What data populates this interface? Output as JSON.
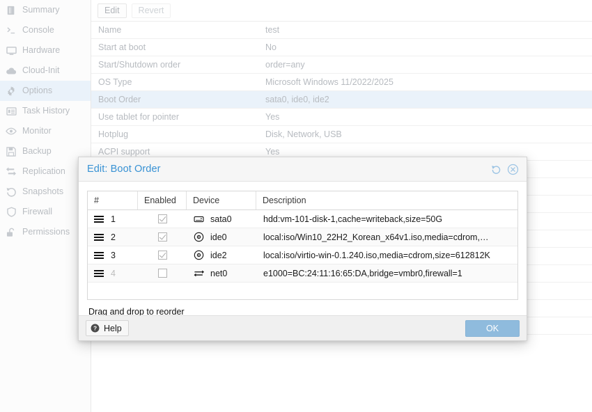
{
  "sidebar": {
    "items": [
      {
        "label": "Summary",
        "icon": "summary-icon",
        "selected": false
      },
      {
        "label": "Console",
        "icon": "console-icon",
        "selected": false
      },
      {
        "label": "Hardware",
        "icon": "hardware-icon",
        "selected": false
      },
      {
        "label": "Cloud-Init",
        "icon": "cloud-icon",
        "selected": false
      },
      {
        "label": "Options",
        "icon": "gear-icon",
        "selected": true
      },
      {
        "label": "Task History",
        "icon": "task-history-icon",
        "selected": false
      },
      {
        "label": "Monitor",
        "icon": "eye-icon",
        "selected": false
      },
      {
        "label": "Backup",
        "icon": "floppy-icon",
        "selected": false
      },
      {
        "label": "Replication",
        "icon": "replication-icon",
        "selected": false
      },
      {
        "label": "Snapshots",
        "icon": "snapshot-icon",
        "selected": false
      },
      {
        "label": "Firewall",
        "icon": "shield-icon",
        "selected": false
      },
      {
        "label": "Permissions",
        "icon": "unlock-icon",
        "selected": false
      }
    ]
  },
  "toolbar": {
    "edit_label": "Edit",
    "revert_label": "Revert"
  },
  "options_table": {
    "rows": [
      {
        "key": "Name",
        "value": "test",
        "highlight": false
      },
      {
        "key": "Start at boot",
        "value": "No",
        "highlight": false
      },
      {
        "key": "Start/Shutdown order",
        "value": "order=any",
        "highlight": false
      },
      {
        "key": "OS Type",
        "value": "Microsoft Windows 11/2022/2025",
        "highlight": false
      },
      {
        "key": "Boot Order",
        "value": "sata0, ide0, ide2",
        "highlight": true
      },
      {
        "key": "Use tablet for pointer",
        "value": "Yes",
        "highlight": false
      },
      {
        "key": "Hotplug",
        "value": "Disk, Network, USB",
        "highlight": false
      },
      {
        "key": "ACPI support",
        "value": "Yes",
        "highlight": false
      }
    ]
  },
  "dialog": {
    "title": "Edit: Boot Order",
    "reset_icon": "reset-icon",
    "close_icon": "close-icon",
    "columns": [
      "#",
      "Enabled",
      "Device",
      "Description"
    ],
    "rows": [
      {
        "order": "1",
        "enabled": true,
        "device": "sata0",
        "device_icon": "harddisk-icon",
        "description": "hdd:vm-101-disk-1,cache=writeback,size=50G",
        "dimmed": false
      },
      {
        "order": "2",
        "enabled": true,
        "device": "ide0",
        "device_icon": "cdrom-icon",
        "description": "local:iso/Win10_22H2_Korean_x64v1.iso,media=cdrom,…",
        "dimmed": false
      },
      {
        "order": "3",
        "enabled": true,
        "device": "ide2",
        "device_icon": "cdrom-icon",
        "description": "local:iso/virtio-win-0.1.240.iso,media=cdrom,size=612812K",
        "dimmed": false
      },
      {
        "order": "4",
        "enabled": false,
        "device": "net0",
        "device_icon": "network-icon",
        "description": "e1000=BC:24:11:16:65:DA,bridge=vmbr0,firewall=1",
        "dimmed": true
      }
    ],
    "hint": "Drag and drop to reorder",
    "help_label": "Help",
    "ok_label": "OK",
    "accent_color": "#3892d4",
    "ok_button_color": "#8fbbdd",
    "highlight_row_color": "#eaf2fa"
  }
}
